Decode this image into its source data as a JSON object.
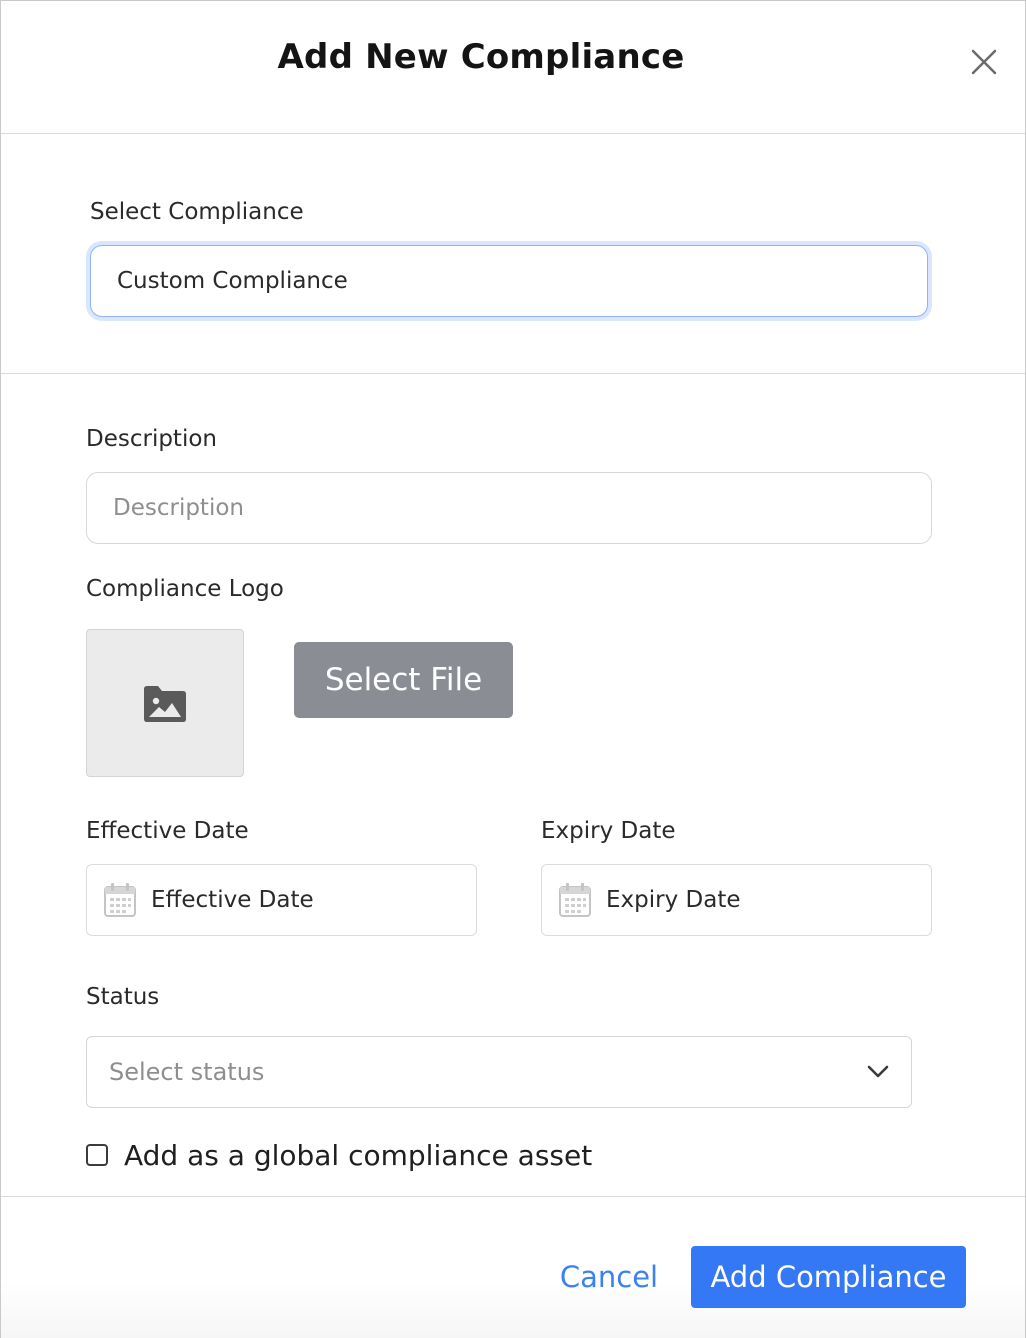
{
  "modal": {
    "title": "Add New Compliance",
    "close_icon": "close-icon"
  },
  "select_compliance": {
    "label": "Select Compliance",
    "value": "Custom Compliance"
  },
  "description": {
    "label": "Description",
    "placeholder": "Description"
  },
  "logo": {
    "label": "Compliance Logo",
    "icon": "image-folder-icon",
    "select_file_label": "Select File"
  },
  "effective_date": {
    "label": "Effective Date",
    "placeholder": "Effective Date",
    "icon": "calendar-icon"
  },
  "expiry_date": {
    "label": "Expiry Date",
    "placeholder": "Expiry Date",
    "icon": "calendar-icon"
  },
  "status": {
    "label": "Status",
    "placeholder": "Select status",
    "icon": "chevron-down-icon"
  },
  "global_asset": {
    "label": "Add as a global compliance asset",
    "checked": false
  },
  "footer": {
    "cancel_label": "Cancel",
    "submit_label": "Add Compliance"
  },
  "colors": {
    "primary": "#3478f6",
    "link": "#3b82f0",
    "select_file_bg": "#8a8e94",
    "focus_ring": "#d9e6fd"
  }
}
